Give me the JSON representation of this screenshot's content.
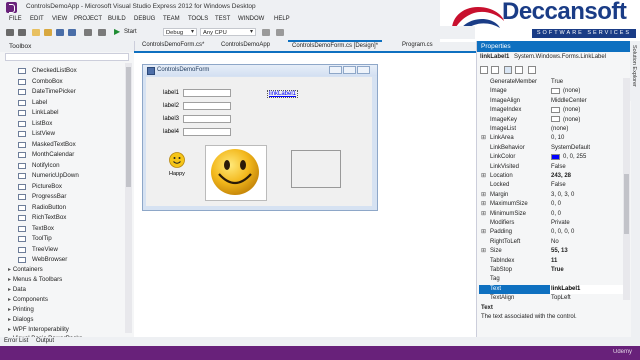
{
  "window": {
    "title": "ControlsDemoApp - Microsoft Visual Studio Express 2012 for Windows Desktop"
  },
  "logo": {
    "brand": "Deccansoft",
    "tagline": "SOFTWARE SERVICES"
  },
  "menu": [
    "FILE",
    "EDIT",
    "VIEW",
    "PROJECT",
    "BUILD",
    "DEBUG",
    "TEAM",
    "TOOLS",
    "TEST",
    "WINDOW",
    "HELP"
  ],
  "toolbar": {
    "start_label": "Start",
    "config": "Debug",
    "platform": "Any CPU"
  },
  "toolbox": {
    "title": "Toolbox",
    "items": [
      "CheckedListBox",
      "ComboBox",
      "DateTimePicker",
      "Label",
      "LinkLabel",
      "ListBox",
      "ListView",
      "MaskedTextBox",
      "MonthCalendar",
      "NotifyIcon",
      "NumericUpDown",
      "PictureBox",
      "ProgressBar",
      "RadioButton",
      "RichTextBox",
      "TextBox",
      "ToolTip",
      "TreeView",
      "WebBrowser"
    ],
    "categories": [
      "Containers",
      "Menus & Toolbars",
      "Data",
      "Components",
      "Printing",
      "Dialogs",
      "WPF Interoperability",
      "Visual Basic PowerPacks"
    ]
  },
  "tabs": [
    "ControlsDemoForm.cs*",
    "ControlsDemoApp",
    "ControlsDemoForm.cs [Design]*",
    "Program.cs"
  ],
  "form": {
    "title": "ControlsDemoForm",
    "labels": [
      "label1",
      "label2",
      "label3",
      "label4"
    ],
    "link": "linkLabel1",
    "happy": "Happy"
  },
  "properties": {
    "title": "Properties",
    "selected_name": "linkLabel1",
    "selected_type": "System.Windows.Forms.LinkLabel",
    "rows": [
      {
        "name": "GenerateMember",
        "value": "True",
        "exp": ""
      },
      {
        "name": "Image",
        "value": "(none)",
        "exp": "",
        "swatch": "#ffffff"
      },
      {
        "name": "ImageAlign",
        "value": "MiddleCenter",
        "exp": ""
      },
      {
        "name": "ImageIndex",
        "value": "(none)",
        "exp": "",
        "swatch": "#ffffff"
      },
      {
        "name": "ImageKey",
        "value": "(none)",
        "exp": "",
        "swatch": "#ffffff"
      },
      {
        "name": "ImageList",
        "value": "(none)",
        "exp": ""
      },
      {
        "name": "LinkArea",
        "value": "0, 10",
        "exp": "⊞"
      },
      {
        "name": "LinkBehavior",
        "value": "SystemDefault",
        "exp": ""
      },
      {
        "name": "LinkColor",
        "value": "0, 0, 255",
        "exp": "",
        "swatch": "#0000ff"
      },
      {
        "name": "LinkVisited",
        "value": "False",
        "exp": ""
      },
      {
        "name": "Location",
        "value": "243, 28",
        "exp": "⊞",
        "bold": true
      },
      {
        "name": "Locked",
        "value": "False",
        "exp": ""
      },
      {
        "name": "Margin",
        "value": "3, 0, 3, 0",
        "exp": "⊞"
      },
      {
        "name": "MaximumSize",
        "value": "0, 0",
        "exp": "⊞"
      },
      {
        "name": "MinimumSize",
        "value": "0, 0",
        "exp": "⊞"
      },
      {
        "name": "Modifiers",
        "value": "Private",
        "exp": ""
      },
      {
        "name": "Padding",
        "value": "0, 0, 0, 0",
        "exp": "⊞"
      },
      {
        "name": "RightToLeft",
        "value": "No",
        "exp": ""
      },
      {
        "name": "Size",
        "value": "55, 13",
        "exp": "⊞",
        "bold": true
      },
      {
        "name": "TabIndex",
        "value": "11",
        "exp": "",
        "bold": true
      },
      {
        "name": "TabStop",
        "value": "True",
        "exp": "",
        "bold": true
      },
      {
        "name": "Tag",
        "value": "",
        "exp": ""
      },
      {
        "name": "Text",
        "value": "linkLabel1",
        "exp": "",
        "bold": true,
        "highlight": true
      },
      {
        "name": "TextAlign",
        "value": "TopLeft",
        "exp": ""
      }
    ],
    "desc_title": "Text",
    "desc_text": "The text associated with the control."
  },
  "side_tab": "Solution Explorer",
  "bottom_tabs": [
    "Error List",
    "Output"
  ],
  "status": "Udemy",
  "colors": {
    "accent": "#0e70c0",
    "status": "#68217a",
    "brand": "#1a3c86"
  }
}
